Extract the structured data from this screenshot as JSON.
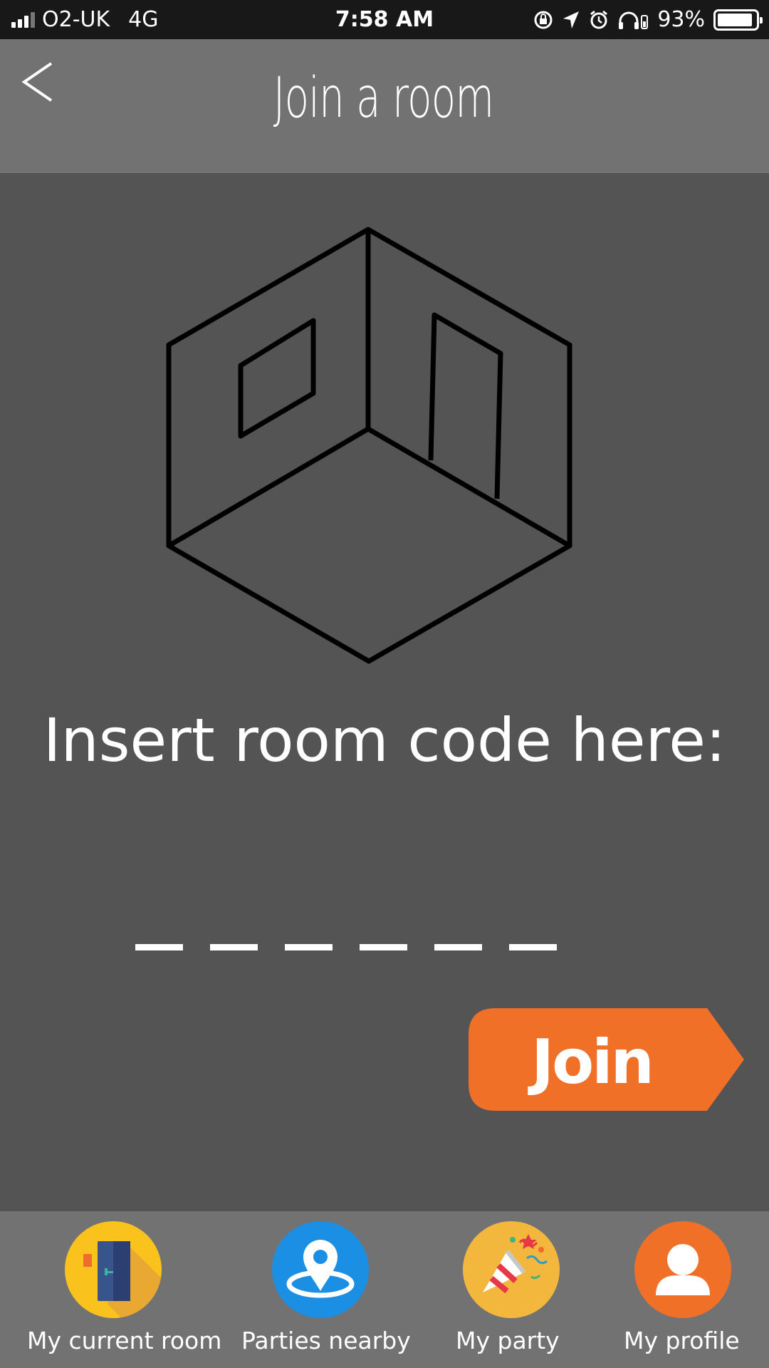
{
  "status_bar": {
    "carrier": "O2-UK",
    "network": "4G",
    "time": "7:58 AM",
    "battery": "93%",
    "battery_level": 0.93
  },
  "header": {
    "title": "Join a room",
    "back_icon": "back-chevron-icon"
  },
  "main": {
    "illustration": "room-cube-icon",
    "prompt": "Insert room code here:",
    "code_length": 6,
    "join_label": "Join",
    "accent_color": "#F07027"
  },
  "nav": {
    "items": [
      {
        "label": "My current room",
        "icon": "door-icon",
        "color": "#F9C21D"
      },
      {
        "label": "Parties nearby",
        "icon": "location-pin-icon",
        "color": "#1A8FE3"
      },
      {
        "label": "My party",
        "icon": "party-popper-icon",
        "color": "#F4B73D"
      },
      {
        "label": "My profile",
        "icon": "user-icon",
        "color": "#F07027"
      }
    ]
  }
}
